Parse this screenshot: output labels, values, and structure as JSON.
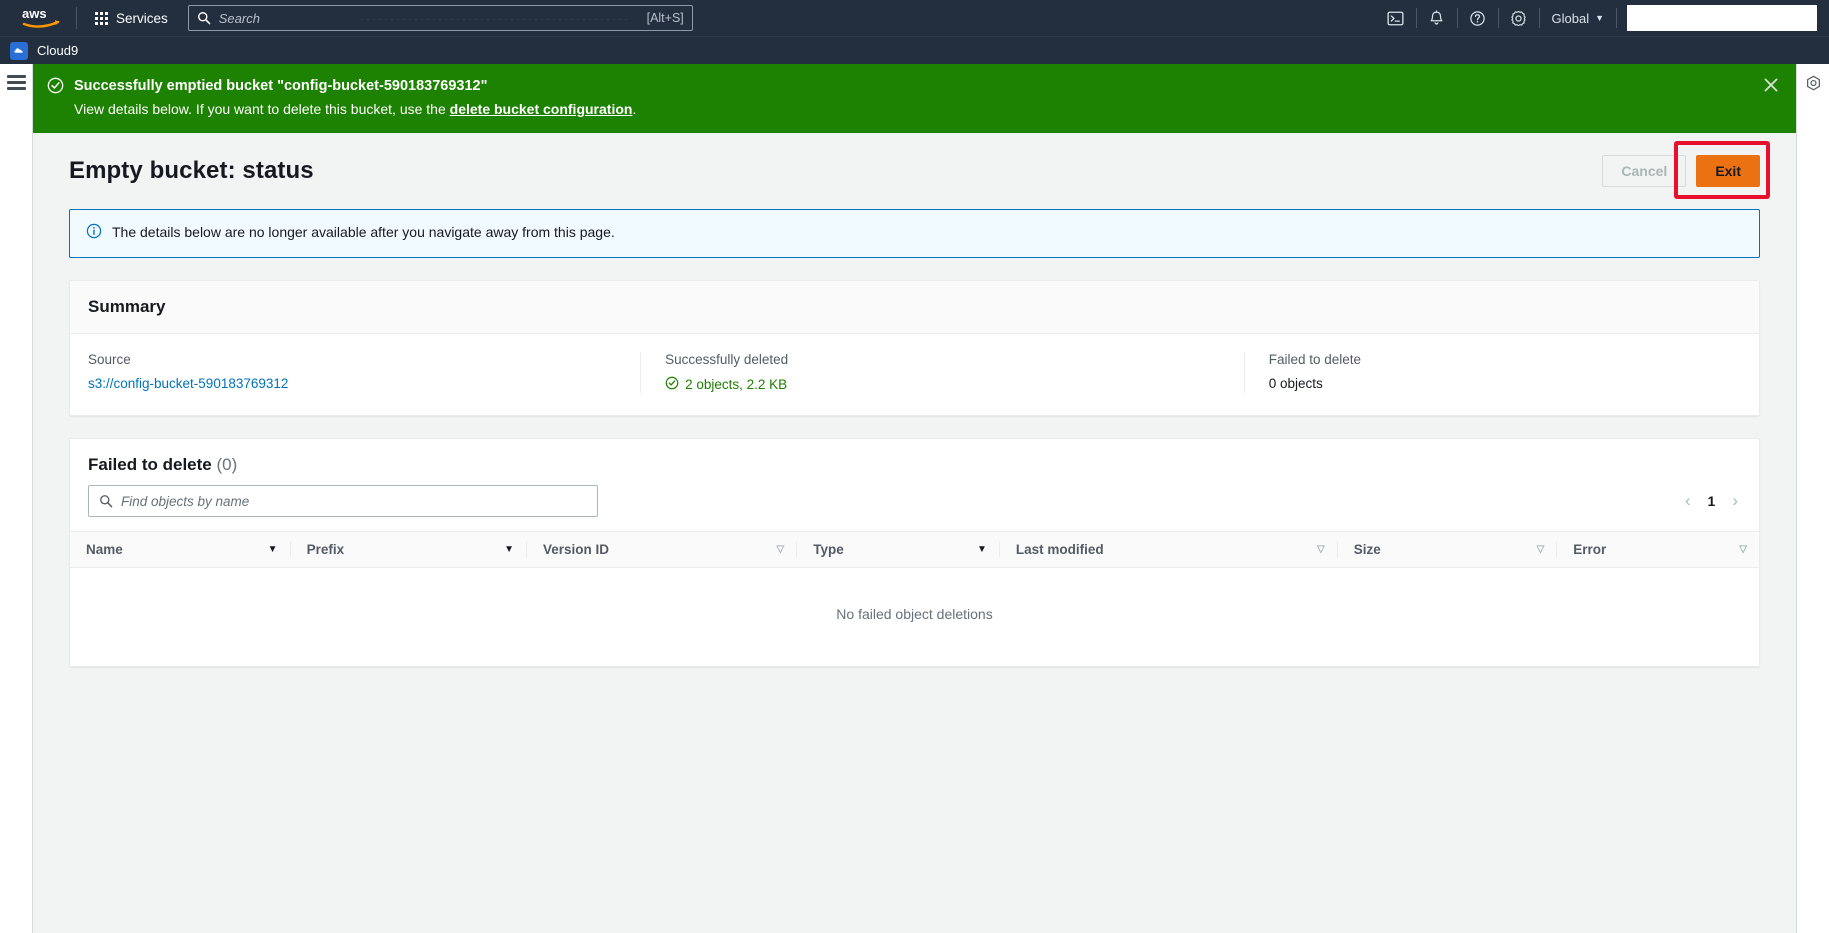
{
  "topnav": {
    "logo_alt": "aws",
    "services_label": "Services",
    "search_placeholder": "Search",
    "search_shortcut": "[Alt+S]",
    "region_label": "Global",
    "region_caret": "▼",
    "icons": [
      "cloudshell-icon",
      "notifications-bell-icon",
      "help-question-icon",
      "settings-gear-icon"
    ]
  },
  "servicebar": {
    "service_name": "Cloud9"
  },
  "flash": {
    "title": "Successfully emptied bucket \"config-bucket-590183769312\"",
    "sub_before": "View details below. If you want to delete this bucket, use the ",
    "sub_link": "delete bucket configuration",
    "sub_after": "."
  },
  "page": {
    "title": "Empty bucket: status",
    "cancel_label": "Cancel",
    "exit_label": "Exit"
  },
  "info_alert": {
    "message": "The details below are no longer available after you navigate away from this page."
  },
  "summary": {
    "heading": "Summary",
    "source_label": "Source",
    "source_value": "s3://config-bucket-590183769312",
    "deleted_label": "Successfully deleted",
    "deleted_value": "2 objects, 2.2 KB",
    "failed_label": "Failed to delete",
    "failed_value": "0 objects"
  },
  "failed_table": {
    "heading": "Failed to delete",
    "count": "(0)",
    "search_placeholder": "Find objects by name",
    "page_number": "1",
    "prev_arrow": "‹",
    "next_arrow": "›",
    "columns": [
      {
        "label": "Name",
        "sort": "▼",
        "dim": false
      },
      {
        "label": "Prefix",
        "sort": "▼",
        "dim": false
      },
      {
        "label": "Version ID",
        "sort": "▽",
        "dim": true
      },
      {
        "label": "Type",
        "sort": "▼",
        "dim": false
      },
      {
        "label": "Last modified",
        "sort": "▽",
        "dim": true
      },
      {
        "label": "Size",
        "sort": "▽",
        "dim": true
      },
      {
        "label": "Error",
        "sort": "▽",
        "dim": true
      }
    ],
    "empty_message": "No failed object deletions"
  },
  "colors": {
    "nav_bg": "#232f3e",
    "success_green": "#1d8102",
    "accent_orange": "#ec7211",
    "link_blue": "#0073bb",
    "highlight_red": "#e8112d"
  }
}
